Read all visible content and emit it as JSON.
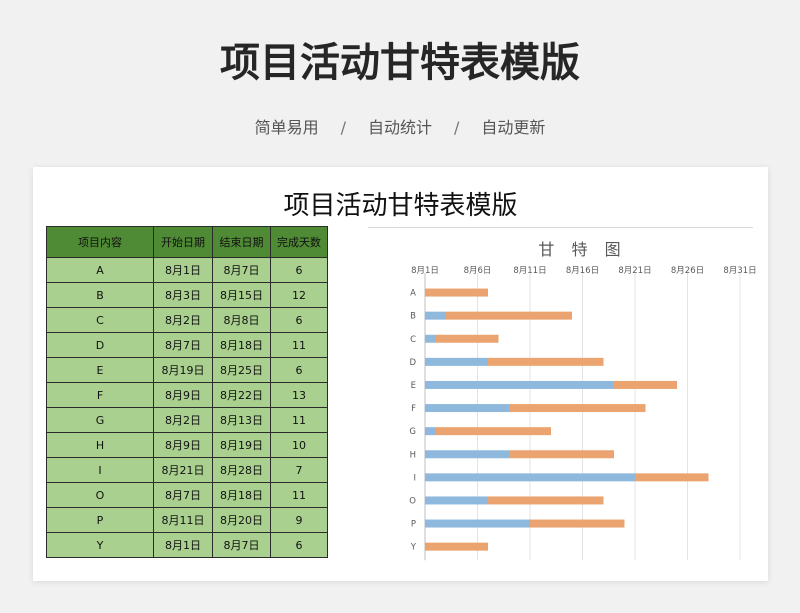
{
  "header": {
    "title": "项目活动甘特表模版",
    "tags": [
      "简单易用",
      "自动统计",
      "自动更新"
    ],
    "separator": "/"
  },
  "sheet": {
    "title": "项目活动甘特表模版",
    "columns": [
      "项目内容",
      "开始日期",
      "结束日期",
      "完成天数"
    ],
    "rows": [
      [
        "A",
        "8月1日",
        "8月7日",
        "6"
      ],
      [
        "B",
        "8月3日",
        "8月15日",
        "12"
      ],
      [
        "C",
        "8月2日",
        "8月8日",
        "6"
      ],
      [
        "D",
        "8月7日",
        "8月18日",
        "11"
      ],
      [
        "E",
        "8月19日",
        "8月25日",
        "6"
      ],
      [
        "F",
        "8月9日",
        "8月22日",
        "13"
      ],
      [
        "G",
        "8月2日",
        "8月13日",
        "11"
      ],
      [
        "H",
        "8月9日",
        "8月19日",
        "10"
      ],
      [
        "I",
        "8月21日",
        "8月28日",
        "7"
      ],
      [
        "O",
        "8月7日",
        "8月18日",
        "11"
      ],
      [
        "P",
        "8月11日",
        "8月20日",
        "9"
      ],
      [
        "Y",
        "8月1日",
        "8月7日",
        "6"
      ]
    ]
  },
  "chart_data": {
    "type": "bar",
    "orientation": "horizontal-stacked",
    "title": "甘 特 图",
    "x_ticks": [
      "8月1日",
      "8月6日",
      "8月11日",
      "8月16日",
      "8月21日",
      "8月26日",
      "8月31日"
    ],
    "xlim_day": [
      1,
      31
    ],
    "categories": [
      "A",
      "B",
      "C",
      "D",
      "E",
      "F",
      "G",
      "H",
      "I",
      "O",
      "P",
      "Y"
    ],
    "series": [
      {
        "color": "#8fb8dd",
        "values": [
          1,
          3,
          2,
          7,
          19,
          9,
          2,
          9,
          21,
          7,
          11,
          1
        ]
      },
      {
        "color": "#eba46f",
        "values": [
          6,
          12,
          6,
          11,
          6,
          13,
          11,
          10,
          7,
          11,
          9,
          6
        ]
      }
    ],
    "grid": true
  }
}
